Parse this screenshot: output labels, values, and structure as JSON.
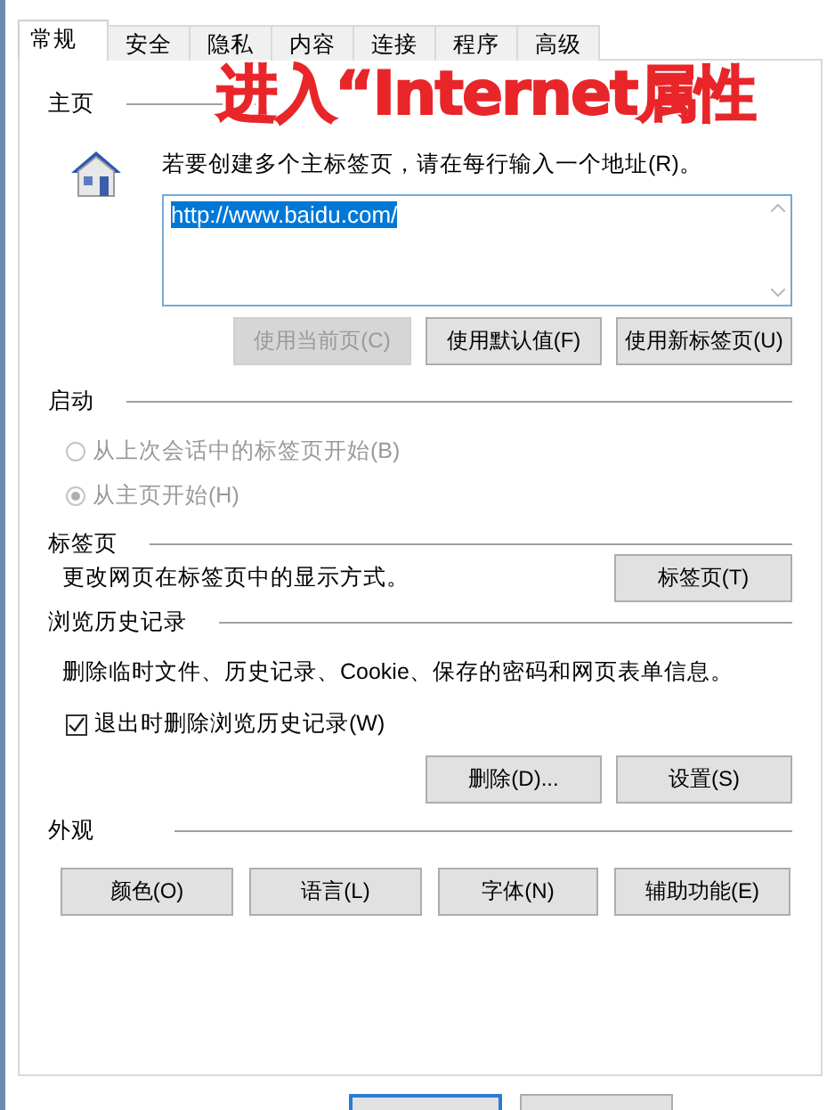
{
  "tabs": [
    {
      "label": "常规",
      "selected": true
    },
    {
      "label": "安全",
      "selected": false
    },
    {
      "label": "隐私",
      "selected": false
    },
    {
      "label": "内容",
      "selected": false
    },
    {
      "label": "连接",
      "selected": false
    },
    {
      "label": "程序",
      "selected": false
    },
    {
      "label": "高级",
      "selected": false
    }
  ],
  "annotation": "进入“Internet属性",
  "home_page": {
    "heading": "主页",
    "instruction": "若要创建多个主标签页，请在每行输入一个地址(R)。",
    "value": "http://www.baidu.com/",
    "buttons": [
      {
        "label": "使用当前页(C)",
        "disabled": true
      },
      {
        "label": "使用默认值(F)",
        "disabled": false
      },
      {
        "label": "使用新标签页(U)",
        "disabled": false
      }
    ]
  },
  "startup": {
    "heading": "启动",
    "options": [
      {
        "label": "从上次会话中的标签页开始(B)",
        "selected": false,
        "disabled": true
      },
      {
        "label": "从主页开始(H)",
        "selected": true,
        "disabled": true
      }
    ]
  },
  "tabs_section": {
    "heading": "标签页",
    "description": "更改网页在标签页中的显示方式。",
    "button": "标签页(T)"
  },
  "history": {
    "heading": "浏览历史记录",
    "description": "删除临时文件、历史记录、Cookie、保存的密码和网页表单信息。",
    "checkbox": {
      "label": "退出时删除浏览历史记录(W)",
      "checked": true
    },
    "buttons": [
      "删除(D)...",
      "设置(S)"
    ]
  },
  "appearance": {
    "heading": "外观",
    "buttons": [
      "颜色(O)",
      "语言(L)",
      "字体(N)",
      "辅助功能(E)"
    ]
  }
}
